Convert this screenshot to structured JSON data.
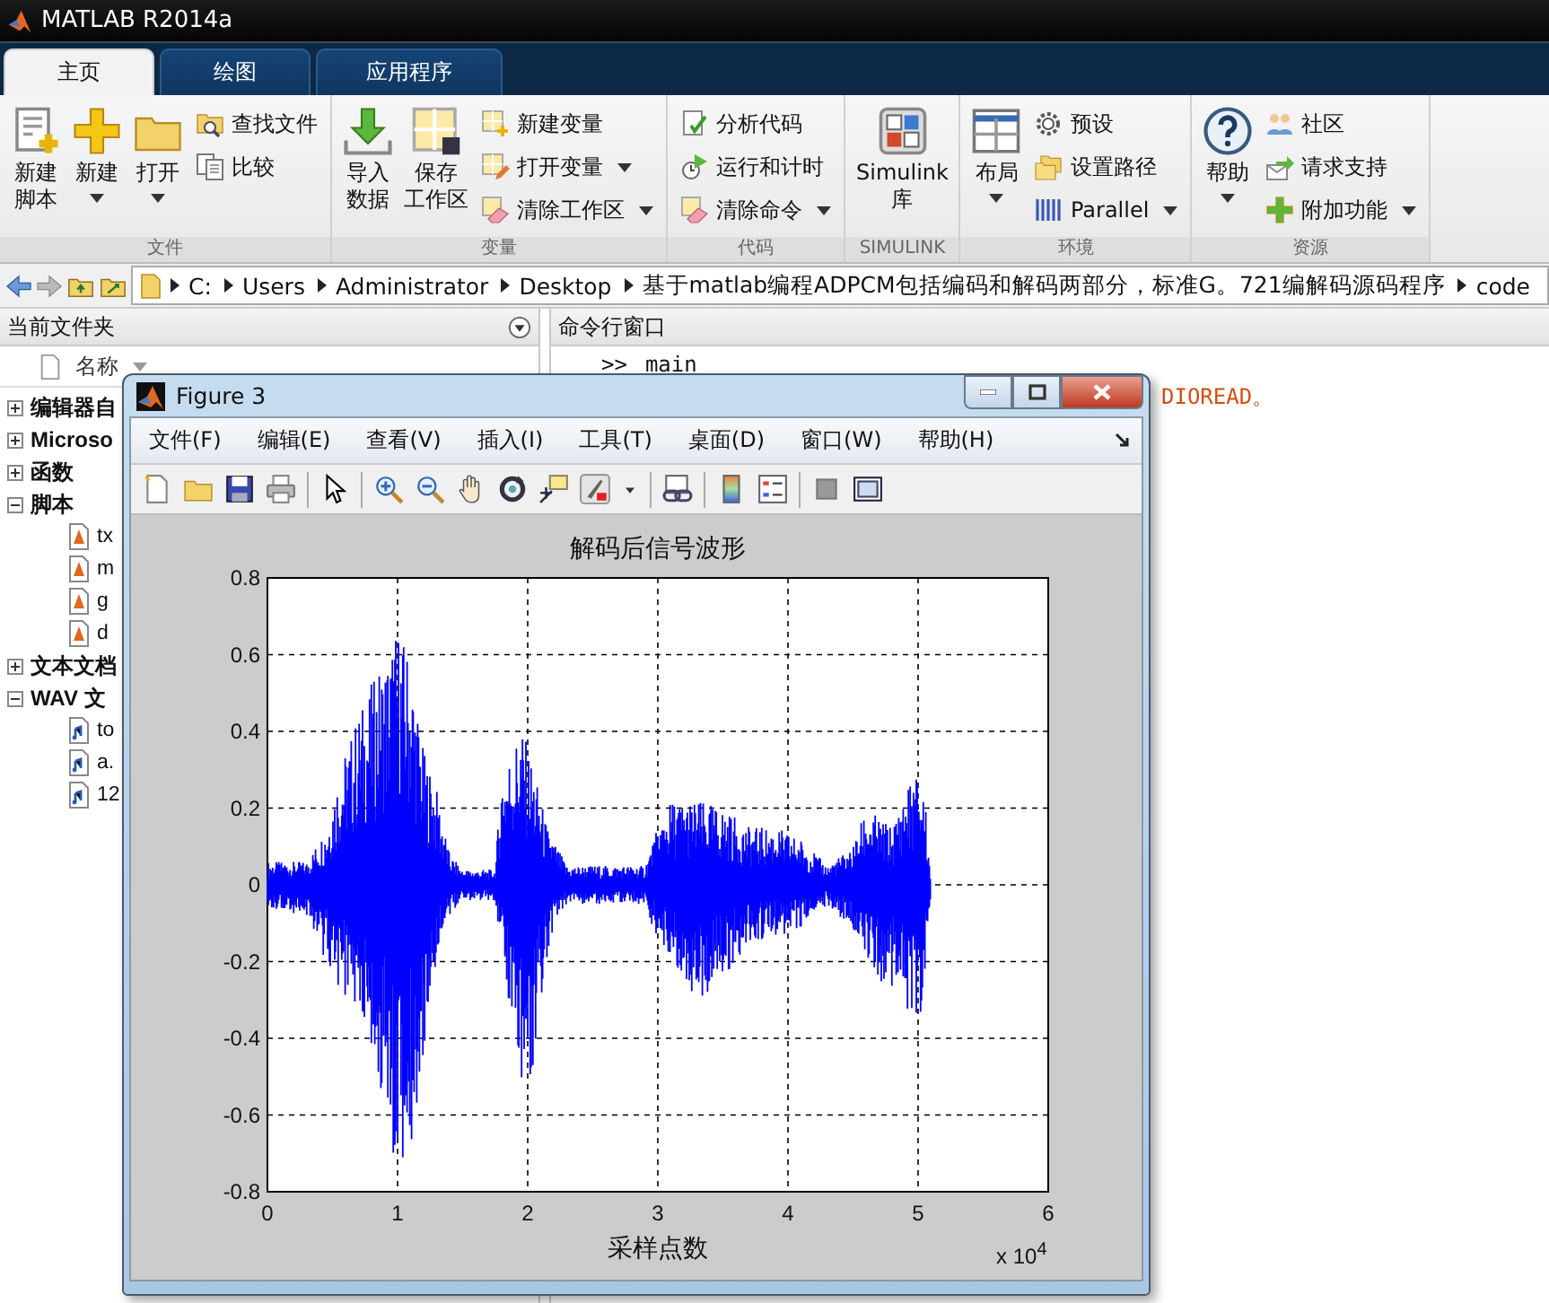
{
  "window": {
    "title": "MATLAB R2014a"
  },
  "tabs": [
    {
      "label": "主页",
      "selected": true
    },
    {
      "label": "绘图",
      "selected": false
    },
    {
      "label": "应用程序",
      "selected": false
    }
  ],
  "ribbon": {
    "groups": [
      {
        "label": "文件",
        "columns": [
          {
            "kind": "large",
            "lines": [
              "新建",
              "脚本"
            ],
            "dropdown": false
          },
          {
            "kind": "large",
            "lines": [
              "新建"
            ],
            "dropdown": true
          },
          {
            "kind": "large",
            "lines": [
              "打开"
            ],
            "dropdown": true
          },
          {
            "kind": "stack",
            "items": [
              {
                "label": "查找文件",
                "dropdown": false
              },
              {
                "label": "比较",
                "dropdown": false
              }
            ]
          }
        ]
      },
      {
        "label": "变量",
        "columns": [
          {
            "kind": "large",
            "lines": [
              "导入",
              "数据"
            ],
            "dropdown": false
          },
          {
            "kind": "large",
            "lines": [
              "保存",
              "工作区"
            ],
            "dropdown": false
          },
          {
            "kind": "stack",
            "items": [
              {
                "label": "新建变量",
                "dropdown": false
              },
              {
                "label": "打开变量",
                "dropdown": true
              },
              {
                "label": "清除工作区",
                "dropdown": true
              }
            ]
          }
        ]
      },
      {
        "label": "代码",
        "columns": [
          {
            "kind": "stack",
            "items": [
              {
                "label": "分析代码",
                "dropdown": false
              },
              {
                "label": "运行和计时",
                "dropdown": false
              },
              {
                "label": "清除命令",
                "dropdown": true
              }
            ]
          }
        ]
      },
      {
        "label": "SIMULINK",
        "columns": [
          {
            "kind": "large",
            "lines": [
              "Simulink",
              "库"
            ],
            "dropdown": false
          }
        ]
      },
      {
        "label": "环境",
        "columns": [
          {
            "kind": "large",
            "lines": [
              "布局"
            ],
            "dropdown": true
          },
          {
            "kind": "stack",
            "items": [
              {
                "label": "预设",
                "dropdown": false
              },
              {
                "label": "设置路径",
                "dropdown": false
              },
              {
                "label": "Parallel",
                "dropdown": true
              }
            ]
          }
        ]
      },
      {
        "label": "资源",
        "columns": [
          {
            "kind": "large",
            "lines": [
              "帮助"
            ],
            "dropdown": true
          },
          {
            "kind": "stack",
            "items": [
              {
                "label": "社区",
                "dropdown": false
              },
              {
                "label": "请求支持",
                "dropdown": false
              },
              {
                "label": "附加功能",
                "dropdown": true
              }
            ]
          }
        ]
      }
    ]
  },
  "address": {
    "segments": [
      "C:",
      "Users",
      "Administrator",
      "Desktop",
      "基于matlab编程ADPCM包括编码和解码两部分，标准G。721编解码源码程序",
      "code"
    ]
  },
  "file_panel": {
    "title": "当前文件夹",
    "column": "名称",
    "tree": [
      {
        "label": "编辑器自",
        "expanded": false
      },
      {
        "label": "Microso",
        "expanded": false
      },
      {
        "label": "函数",
        "expanded": false
      },
      {
        "label": "脚本",
        "expanded": true,
        "children": [
          {
            "label": "tx",
            "kind": "script"
          },
          {
            "label": "m",
            "kind": "script"
          },
          {
            "label": "g",
            "kind": "script"
          },
          {
            "label": "d",
            "kind": "script"
          }
        ]
      },
      {
        "label": "文本文档",
        "expanded": false
      },
      {
        "label": "WAV 文",
        "expanded": true,
        "children": [
          {
            "label": "to",
            "kind": "audio"
          },
          {
            "label": "a.",
            "kind": "audio"
          },
          {
            "label": "12",
            "kind": "audio"
          }
        ]
      }
    ]
  },
  "command_window": {
    "title": "命令行窗口",
    "lines": [
      {
        "kind": "input",
        "prompt": ">>",
        "text": "main"
      },
      {
        "kind": "warning",
        "text": "DIOREAD。"
      }
    ]
  },
  "figure": {
    "title": "Figure 3",
    "menu": [
      "文件(F)",
      "编辑(E)",
      "查看(V)",
      "插入(I)",
      "工具(T)",
      "桌面(D)",
      "窗口(W)",
      "帮助(H)"
    ],
    "plot": {
      "title": "解码后信号波形",
      "xlabel": "采样点数",
      "xticks": [
        "0",
        "1",
        "2",
        "3",
        "4",
        "5",
        "6"
      ],
      "yticks": [
        "0.8",
        "0.6",
        "0.4",
        "0.2",
        "0",
        "-0.2",
        "-0.4",
        "-0.6",
        "-0.8"
      ],
      "exponent": "x 10$^{4}$"
    }
  }
}
